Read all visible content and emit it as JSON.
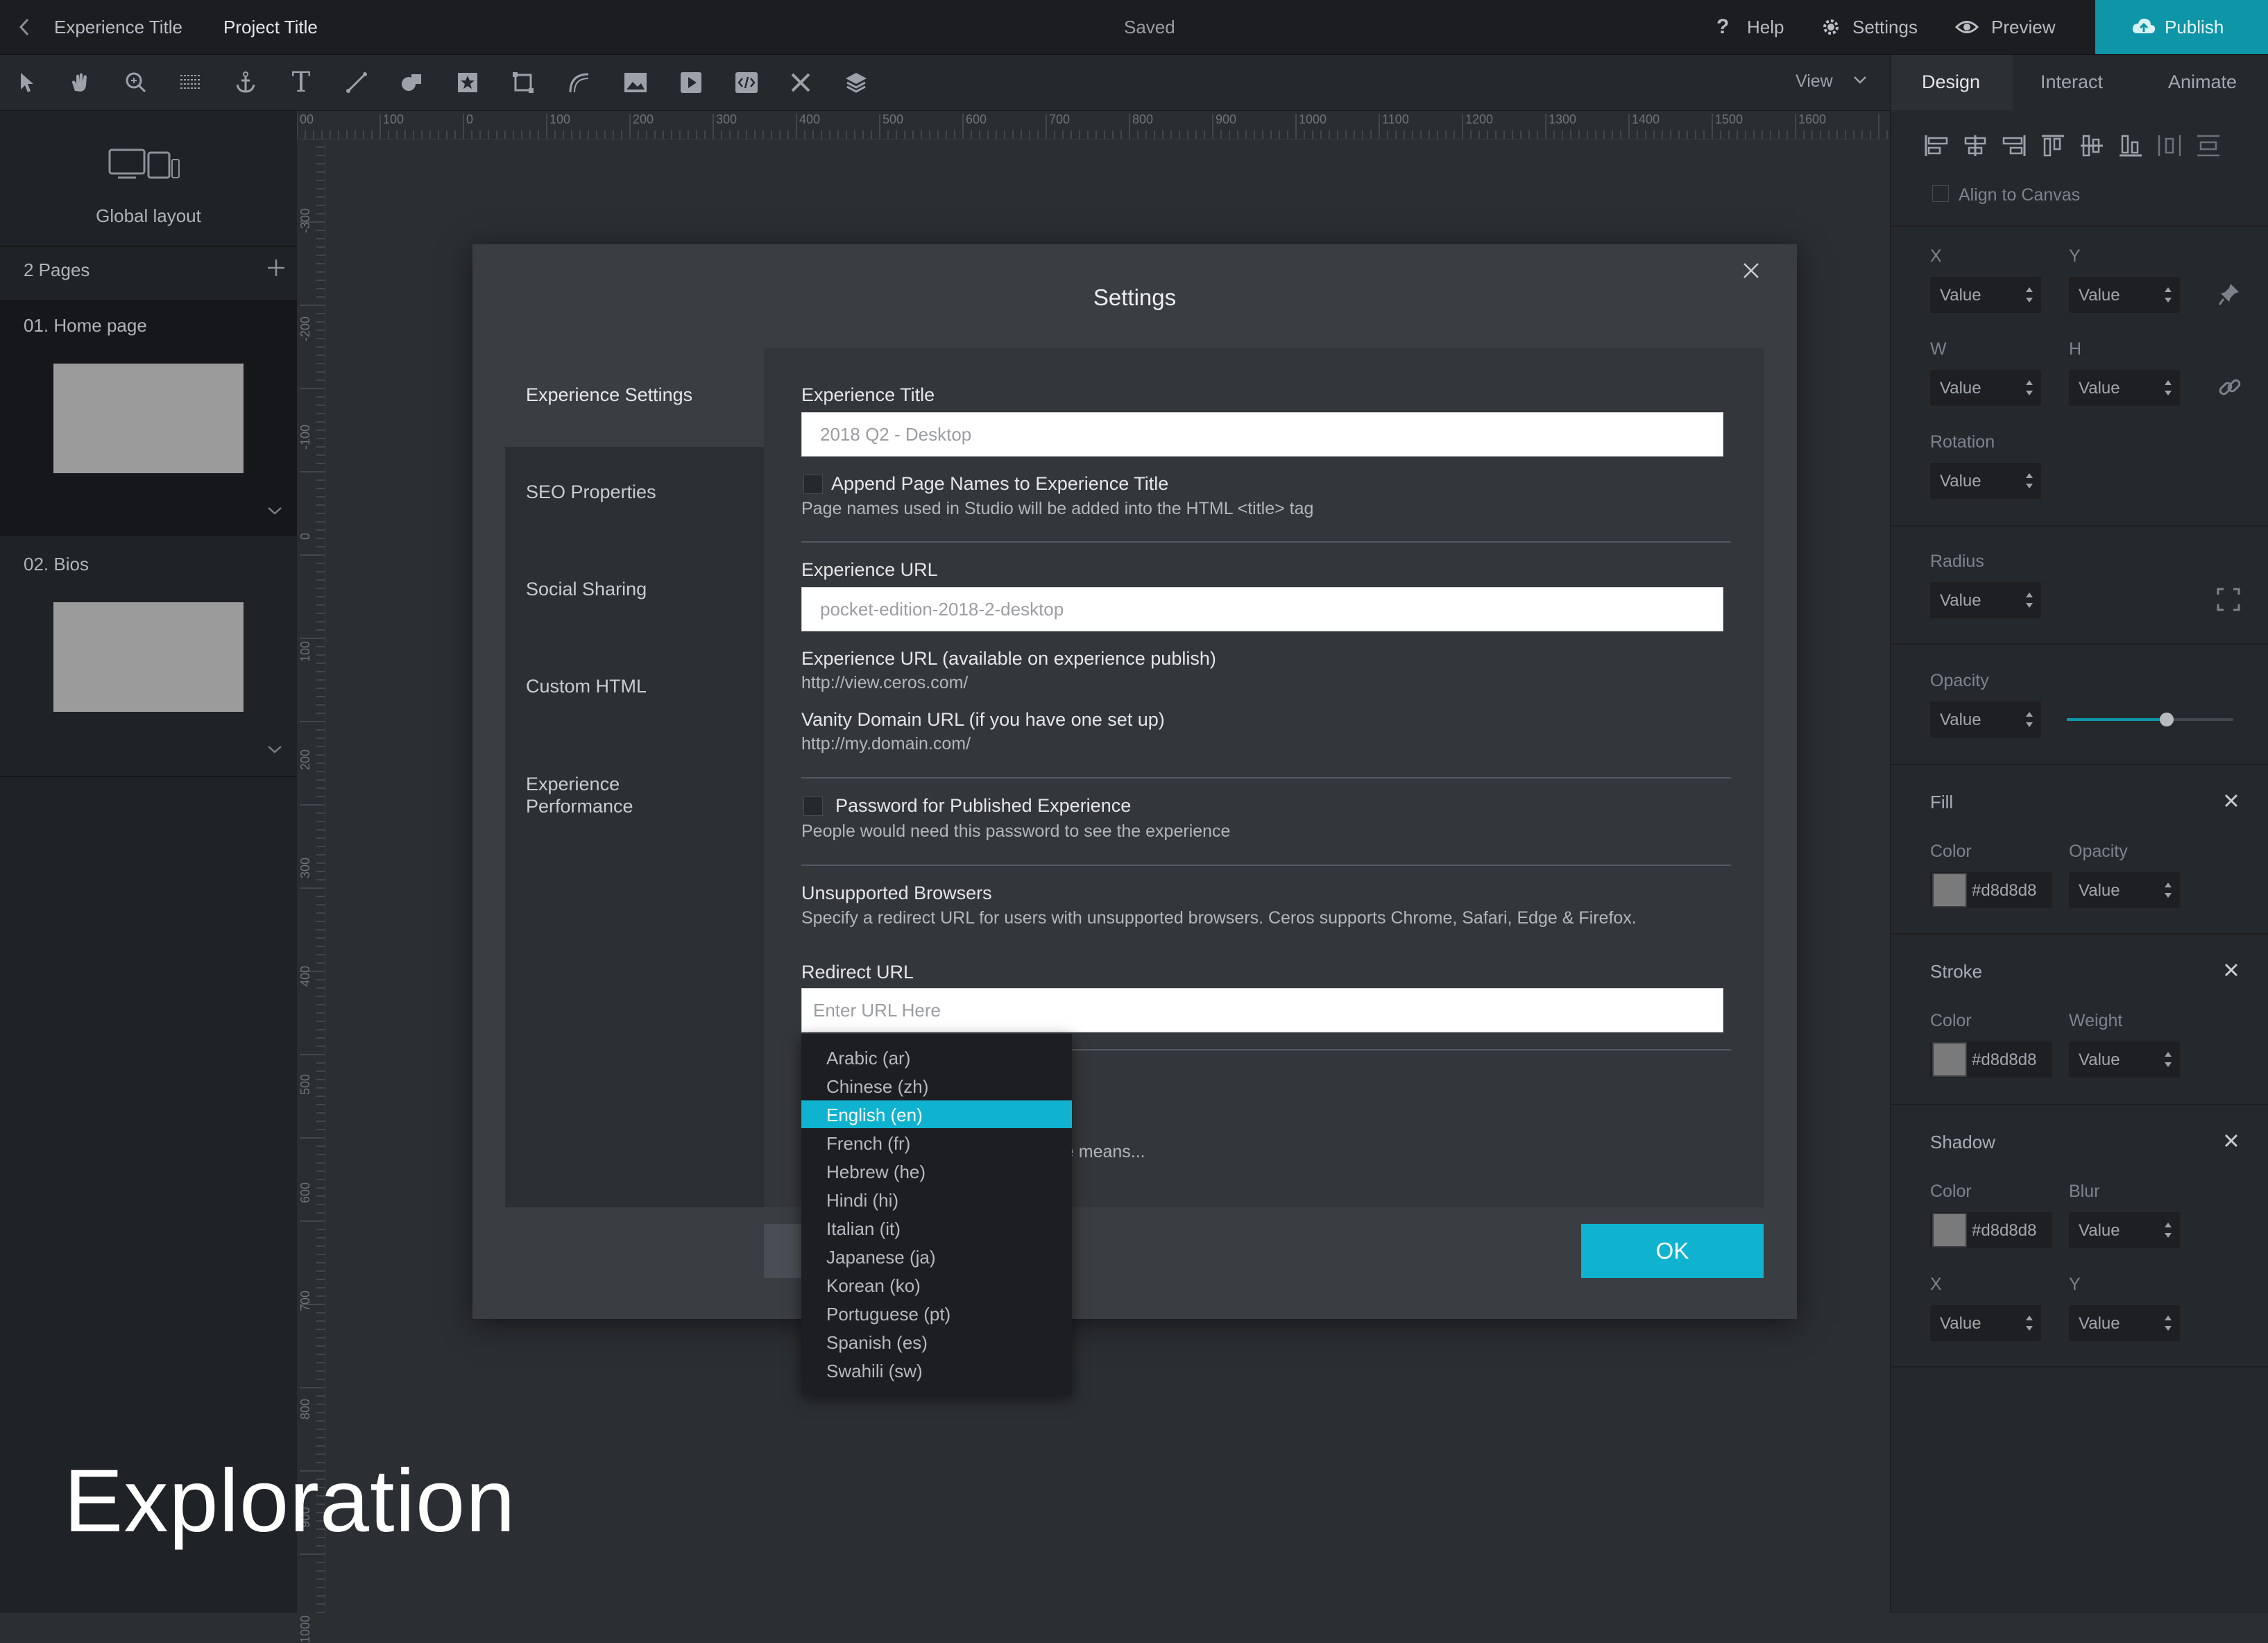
{
  "topbar": {
    "back_icon": "chevron-left-icon",
    "experience_title": "Experience Title",
    "project_title": "Project Title",
    "status": "Saved",
    "help": "Help",
    "settings": "Settings",
    "preview": "Preview",
    "publish": "Publish"
  },
  "toolbar": {
    "tools": [
      "pointer-icon",
      "hand-icon",
      "zoom-icon",
      "pattern-icon",
      "anchor-icon",
      "text-icon",
      "line-icon",
      "shapes-icon",
      "star-icon",
      "crop-icon",
      "curve-icon",
      "image-icon",
      "video-icon",
      "code-icon",
      "tools-icon",
      "layers-icon"
    ],
    "view_label": "View"
  },
  "right_tabs": [
    "Design",
    "Interact",
    "Animate"
  ],
  "left_panel": {
    "global_layout": "Global layout",
    "pages_count": "2 Pages",
    "pages": [
      {
        "label": "01. Home page"
      },
      {
        "label": "02. Bios"
      }
    ]
  },
  "rulers": {
    "top": [
      "00",
      "100",
      "0",
      "100",
      "200",
      "300",
      "400",
      "500",
      "600",
      "700",
      "800",
      "900",
      "1000",
      "1100",
      "1200",
      "1300",
      "1400",
      "1500",
      "1600"
    ],
    "left": [
      "-300",
      "-200",
      "-100",
      "0",
      "100",
      "200",
      "300",
      "400",
      "500",
      "600",
      "700",
      "800",
      "900",
      "1000"
    ]
  },
  "design_panel": {
    "align_to_canvas": "Align to Canvas",
    "x_label": "X",
    "y_label": "Y",
    "w_label": "W",
    "h_label": "H",
    "rotation_label": "Rotation",
    "radius_label": "Radius",
    "opacity_label": "Opacity",
    "value_placeholder": "Value",
    "opacity_slider": 0.6,
    "fill": {
      "title": "Fill",
      "color_label": "Color",
      "opacity_label": "Opacity",
      "color": "#d8d8d8"
    },
    "stroke": {
      "title": "Stroke",
      "color_label": "Color",
      "weight_label": "Weight",
      "color": "#d8d8d8"
    },
    "shadow": {
      "title": "Shadow",
      "color_label": "Color",
      "blur_label": "Blur",
      "x_label": "X",
      "y_label": "Y",
      "color": "#d8d8d8"
    }
  },
  "dialog": {
    "title": "Settings",
    "nav": [
      "Experience Settings",
      "SEO Properties",
      "Social Sharing",
      "Custom HTML",
      "Experience Performance"
    ],
    "experience_title_label": "Experience Title",
    "experience_title_value": "2018 Q2 - Desktop",
    "append_label": "Append Page Names to Experience Title",
    "append_help": "Page names used in Studio will be added into the HTML <title> tag",
    "url_label": "Experience URL",
    "url_value": "pocket-edition-2018-2-desktop",
    "publish_url_label": "Experience URL (available on experience publish)",
    "publish_url_value": "http://view.ceros.com/",
    "vanity_label": "Vanity Domain URL (if you have one set up)",
    "vanity_value": "http://my.domain.com/",
    "password_label": "Password for Published Experience",
    "password_help": "People would need this password to see the experience",
    "unsupported_label": "Unsupported Browsers",
    "unsupported_help": "Specify a redirect URL for users with unsupported browsers. Ceros supports Chrome, Safari, Edge & Firefox.",
    "redirect_label": "Redirect URL",
    "redirect_placeholder": "Enter URL Here",
    "partial_text": "ge means...",
    "ok": "OK"
  },
  "language_options": [
    "Arabic (ar)",
    "Chinese (zh)",
    "English (en)",
    "French (fr)",
    "Hebrew (he)",
    "Hindi (hi)",
    "Italian (it)",
    "Japanese (ja)",
    "Korean (ko)",
    "Portuguese (pt)",
    "Spanish (es)",
    "Swahili (sw)"
  ],
  "selected_language": "English (en)",
  "overlay_caption": "Exploration",
  "colors": {
    "accent": "#0fb3cf",
    "publish": "#0f95a8"
  }
}
